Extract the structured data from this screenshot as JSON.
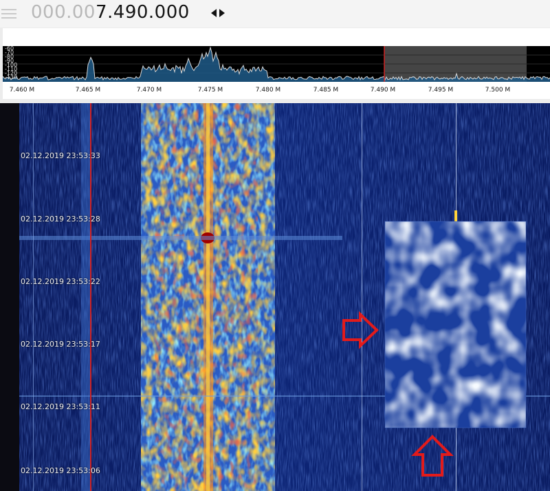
{
  "frequency": {
    "dim_digits": "000.00",
    "active_digits": "7.490.000"
  },
  "spectrum": {
    "y_labels": [
      "-60",
      "-70",
      "-80",
      "-90",
      "-100",
      "-110",
      "-120",
      "-130"
    ],
    "x_ticks": [
      "7.460 M",
      "7.465 M",
      "7.470 M",
      "7.475 M",
      "7.480 M",
      "7.485 M",
      "7.490 M",
      "7.495 M",
      "7.500 M"
    ],
    "marker_label": "7.490 M"
  },
  "waterfall": {
    "timestamps": [
      "02.12.2019 23:53:33",
      "02.12.2019 23:53:28",
      "02.12.2019 23:53:22",
      "02.12.2019 23:53:17",
      "02.12.2019 23:53:11",
      "02.12.2019 23:53:06"
    ]
  },
  "colors": {
    "background": "#0b1d63",
    "tuning_marker": "#d02020",
    "annotation_arrow": "#e21b1b",
    "spectrum_fill": "#1e4f7a"
  },
  "icons": {
    "tune_arrows": "left-right-arrows-icon",
    "annotation": "red-outline-arrow-icon"
  }
}
